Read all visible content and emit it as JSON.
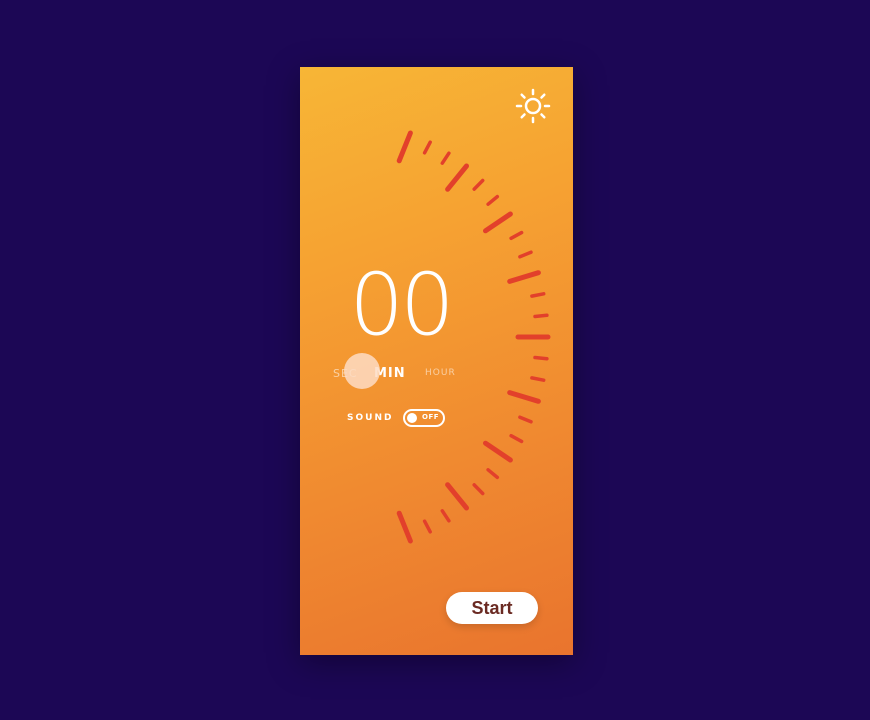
{
  "timer": {
    "value": "00",
    "selected_unit": "MIN"
  },
  "units": {
    "sec": "SEC",
    "min": "MIN",
    "hour": "HOUR"
  },
  "sound": {
    "label": "SOUND",
    "state": "OFF"
  },
  "actions": {
    "start_label": "Start"
  },
  "icons": {
    "theme_toggle": "sun-icon"
  },
  "colors": {
    "background": "#1c0755",
    "gradient_top": "#f7b636",
    "gradient_bottom": "#e9742e",
    "tick": "#e2402b",
    "text": "#ffffff"
  }
}
